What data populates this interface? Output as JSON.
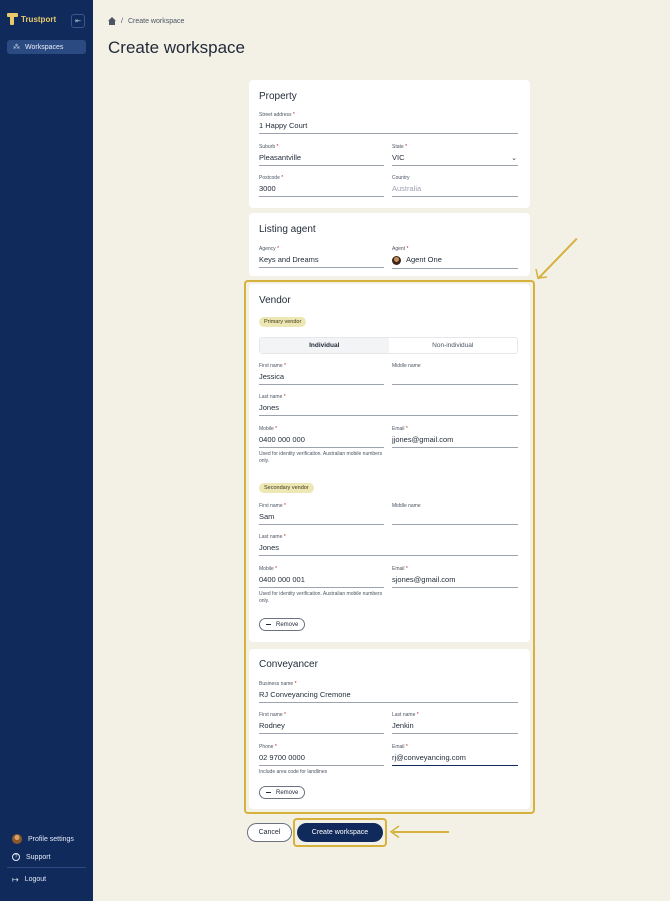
{
  "sidebar": {
    "brand": "Trustport",
    "nav": [
      {
        "label": "Workspaces",
        "icon": "workspaces-icon"
      }
    ],
    "bottom": [
      {
        "label": "Profile settings",
        "icon": "avatar"
      },
      {
        "label": "Support",
        "icon": "help-icon"
      },
      {
        "label": "Logout",
        "icon": "logout-icon"
      }
    ]
  },
  "breadcrumb": {
    "separator": "/",
    "current": "Create workspace"
  },
  "page_title": "Create workspace",
  "property": {
    "title": "Property",
    "street": {
      "label": "Street address",
      "value": "1 Happy Court"
    },
    "suburb": {
      "label": "Suburb",
      "value": "Pleasantville"
    },
    "state": {
      "label": "State",
      "value": "VIC"
    },
    "postcode": {
      "label": "Postcode",
      "value": "3000"
    },
    "country": {
      "label": "Country",
      "placeholder": "Australia"
    }
  },
  "listing_agent": {
    "title": "Listing agent",
    "agency": {
      "label": "Agency",
      "value": "Keys and Dreams"
    },
    "agent": {
      "label": "Agent",
      "value": "Agent One"
    }
  },
  "vendor": {
    "title": "Vendor",
    "primary": {
      "badge": "Primary vendor",
      "toggle": [
        "Individual",
        "Non-individual"
      ],
      "first_name": {
        "label": "First name",
        "value": "Jessica"
      },
      "middle_name": {
        "label": "Middle name",
        "value": ""
      },
      "last_name": {
        "label": "Last name",
        "value": "Jones"
      },
      "mobile": {
        "label": "Mobile",
        "value": "0400 000 000",
        "hint": "Used for identity verification. Australian mobile numbers only."
      },
      "email": {
        "label": "Email",
        "value": "jjones@gmail.com"
      }
    },
    "secondary": {
      "badge": "Secondary vendor",
      "first_name": {
        "label": "First name",
        "value": "Sam"
      },
      "middle_name": {
        "label": "Middle name",
        "value": ""
      },
      "last_name": {
        "label": "Last name",
        "value": "Jones"
      },
      "mobile": {
        "label": "Mobile",
        "value": "0400 000 001",
        "hint": "Used for identity verification. Australian mobile numbers only."
      },
      "email": {
        "label": "Email",
        "value": "sjones@gmail.com"
      },
      "remove_label": "Remove"
    }
  },
  "conveyancer": {
    "title": "Conveyancer",
    "business": {
      "label": "Business name",
      "value": "RJ Conveyancing Cremone"
    },
    "first_name": {
      "label": "First name",
      "value": "Rodney"
    },
    "last_name": {
      "label": "Last name",
      "value": "Jenkin"
    },
    "phone": {
      "label": "Phone",
      "value": "02 9700 0000",
      "hint": "Include area code for landlines"
    },
    "email": {
      "label": "Email",
      "value": "rj@conveyancing.com"
    },
    "remove_label": "Remove"
  },
  "actions": {
    "cancel": "Cancel",
    "create": "Create workspace"
  },
  "colors": {
    "sidebar": "#102a5c",
    "highlight": "#d6b13c",
    "background": "#f3f0e6"
  }
}
